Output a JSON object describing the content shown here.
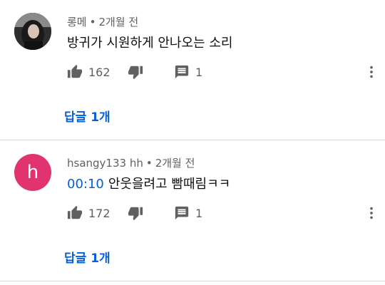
{
  "comments": [
    {
      "author": "롱메",
      "time": "2개월 전",
      "text": "방귀가 시원하게 안나오는 소리",
      "likes": "162",
      "reply_count": "1",
      "replies_label": "답글 1개",
      "avatar_color": "#3b3b3b"
    },
    {
      "author": "hsangy133 hh",
      "time": "2개월 전",
      "timestamp": "00:10",
      "text": "안웃을려고 빰때림ㅋㅋ",
      "likes": "172",
      "reply_count": "1",
      "replies_label": "답글 1개",
      "avatar_letter": "h",
      "avatar_color": "#e0336f"
    }
  ],
  "dot": "•",
  "colors": {
    "link": "#065fd4",
    "muted": "#606060",
    "icon": "#606060"
  },
  "icons": {
    "like": "thumb-up-icon",
    "dislike": "thumb-down-icon",
    "reply": "comment-icon",
    "more": "more-vert-icon"
  }
}
